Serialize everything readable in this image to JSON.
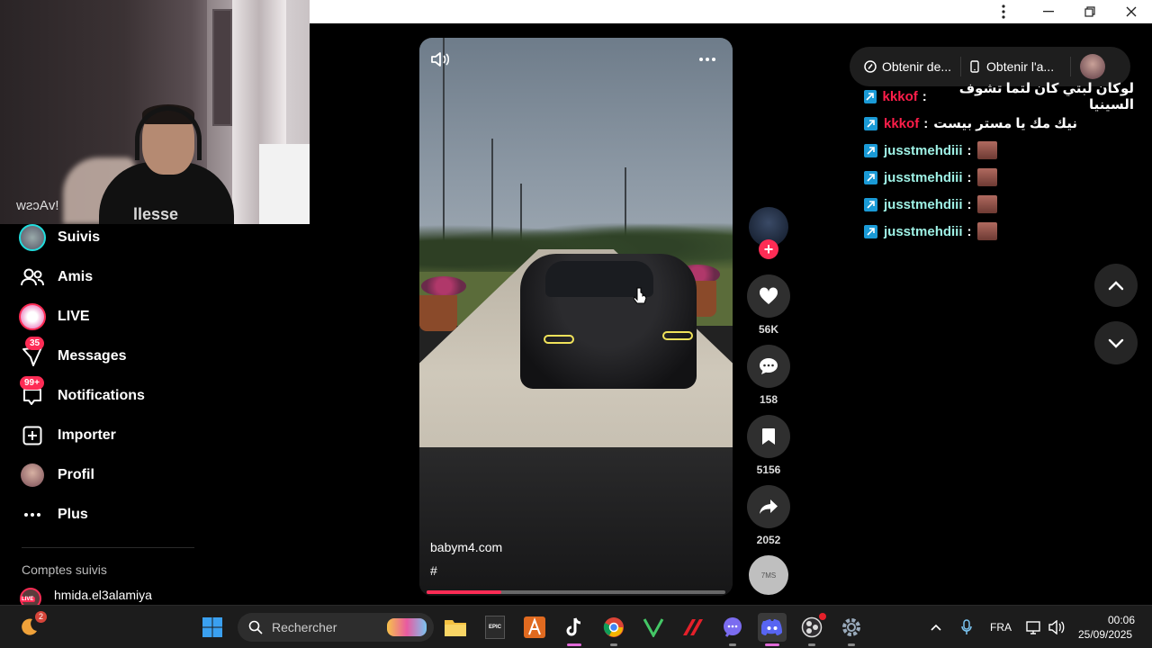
{
  "window": {
    "controls": [
      "more-options",
      "minimize",
      "restore",
      "close"
    ]
  },
  "webcam": {
    "shirt_text": "llesse",
    "mirrored_text": "!vAcsw"
  },
  "sidebar": {
    "items": [
      {
        "label": "Suivis",
        "icon": "following-avatar-icon"
      },
      {
        "label": "Amis",
        "icon": "friends-icon"
      },
      {
        "label": "LIVE",
        "icon": "live-icon"
      },
      {
        "label": "Messages",
        "icon": "messages-icon",
        "badge": "35"
      },
      {
        "label": "Notifications",
        "icon": "notifications-icon",
        "badge": "99+"
      },
      {
        "label": "Importer",
        "icon": "upload-icon"
      },
      {
        "label": "Profil",
        "icon": "profile-avatar-icon"
      },
      {
        "label": "Plus",
        "icon": "more-icon"
      }
    ],
    "followed_title": "Comptes suivis",
    "followed_accounts": [
      {
        "name": "hmida.el3alamiya",
        "live_badge": "LIVE"
      }
    ]
  },
  "video": {
    "author": "babym4.com",
    "hashtag": "#",
    "progress_fraction": 0.25
  },
  "actions": {
    "likes": "56K",
    "comments": "158",
    "saves": "5156",
    "shares": "2052",
    "music_disc_label": "7MS"
  },
  "top_pill": {
    "item1": "Obtenir de...",
    "item2": "Obtenir l'a..."
  },
  "chat": {
    "lines": [
      {
        "user": "kkkof",
        "color": "red",
        "message": "لوكان لبتي كان لتما تشوف السينيا",
        "emote": false
      },
      {
        "user": "kkkof",
        "color": "red",
        "message": "نيك مك يا مستر بيست",
        "emote": false
      },
      {
        "user": "jusstmehdiii",
        "color": "teal",
        "message": "",
        "emote": true
      },
      {
        "user": "jusstmehdiii",
        "color": "teal",
        "message": "",
        "emote": true
      },
      {
        "user": "jusstmehdiii",
        "color": "teal",
        "message": "",
        "emote": true
      },
      {
        "user": "jusstmehdiii",
        "color": "teal",
        "message": "",
        "emote": true
      }
    ],
    "colon": ":"
  },
  "taskbar": {
    "search_placeholder": "Rechercher",
    "start_badge": "2",
    "language": "FRA",
    "time": "00:06",
    "date": "25/09/2025",
    "epic_label": "EPIC"
  },
  "colors": {
    "accent": "#fe2c55",
    "chat_red": "#ff1e4a",
    "chat_teal": "#9ff2e6"
  }
}
